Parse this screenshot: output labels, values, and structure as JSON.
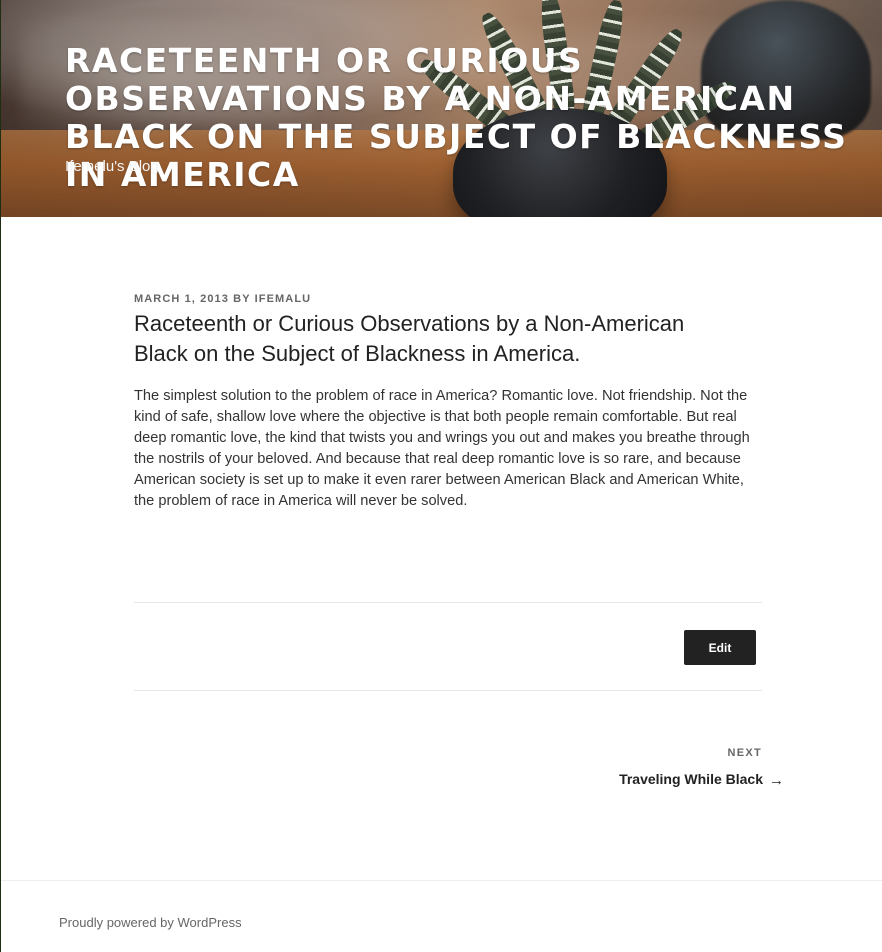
{
  "header": {
    "site_title": "RACETEENTH OR CURIOUS OBSERVATIONS BY A NON-AMERICAN BLACK ON THE SUBJECT OF BLACKNESS IN AMERICA",
    "tagline": "Ifemelu's Blog"
  },
  "post": {
    "date": "MARCH 1, 2013",
    "by": "BY",
    "author": "IFEMALU",
    "title": "Raceteenth or Curious Observations by a Non-American Black on the Subject of Blackness in America.",
    "content": "The simplest solution to the problem of race in America? Romantic love. Not friendship. Not the kind of safe, shallow love where the objective is that both people remain comfortable. But real deep romantic love, the kind that twists you and wrings you out and makes you breathe through the nostrils of your beloved. And because that real deep romantic love is so rare, and because American society is set up to make it even rarer between American Black and American White, the problem of race in America will never be solved."
  },
  "actions": {
    "edit_label": "Edit"
  },
  "navigation": {
    "next_label": "NEXT",
    "next_title": "Traveling While Black",
    "next_arrow": "→"
  },
  "footer": {
    "powered_by": "Proudly powered by WordPress"
  },
  "icons": {
    "next_arrow_icon": "right-arrow-icon"
  }
}
